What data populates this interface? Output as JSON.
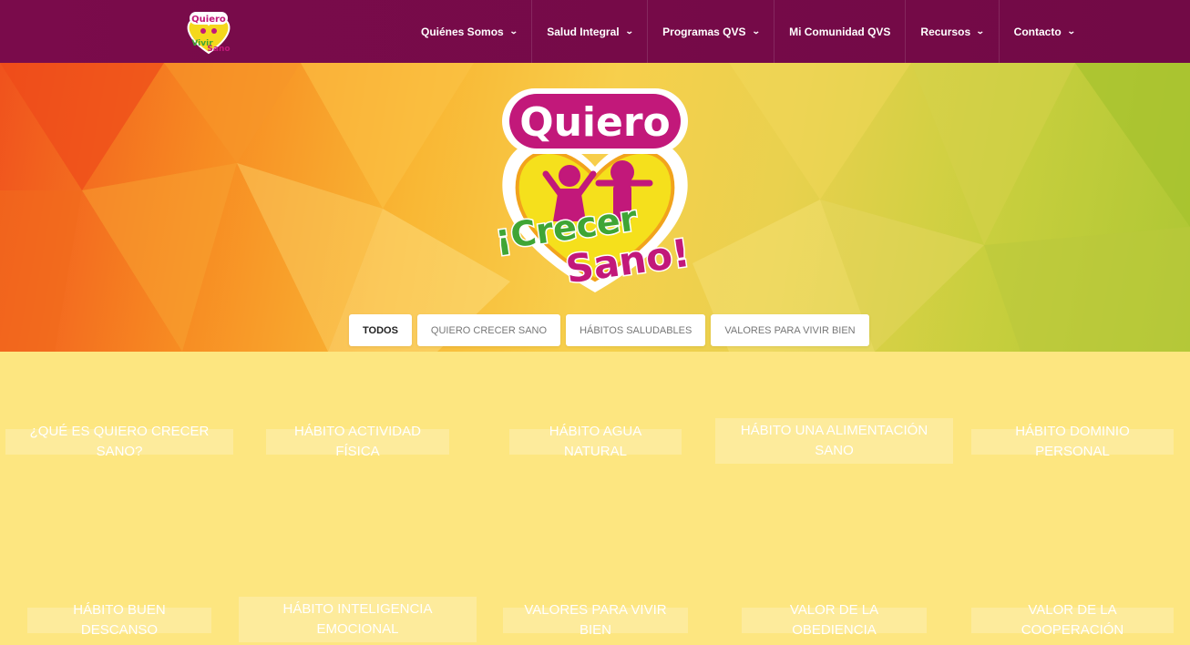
{
  "nav": {
    "logo_top": "Quiero",
    "logo_bottom": "Vivir Sano",
    "items": [
      {
        "label": "Quiénes Somos",
        "has_dropdown": true
      },
      {
        "label": "Salud Integral",
        "has_dropdown": true
      },
      {
        "label": "Programas QVS",
        "has_dropdown": true
      },
      {
        "label": "Mi Comunidad QVS",
        "has_dropdown": false
      },
      {
        "label": "Recursos",
        "has_dropdown": true
      },
      {
        "label": "Contacto",
        "has_dropdown": true
      }
    ]
  },
  "hero": {
    "logo_top": "Quiero",
    "logo_line1": "¡Crecer",
    "logo_line2": "Sano!",
    "filters": [
      {
        "label": "TODOS",
        "active": true
      },
      {
        "label": "QUIERO CRECER SANO",
        "active": false
      },
      {
        "label": "HÁBITOS SALUDABLES",
        "active": false
      },
      {
        "label": "VALORES PARA VIVIR BIEN",
        "active": false
      }
    ]
  },
  "grid": {
    "items": [
      "¿QUÉ ES QUIERO CRECER SANO?",
      "HÁBITO ACTIVIDAD FÍSICA",
      "HÁBITO AGUA NATURAL",
      "HÁBITO UNA ALIMENTACIÓN SANO",
      "HÁBITO DOMINIO PERSONAL",
      "HÁBITO BUEN DESCANSO",
      "HÁBITO INTELIGENCIA EMOCIONAL",
      "VALORES PARA VIVIR BIEN",
      "VALOR DE LA OBEDIENCIA",
      "VALOR DE LA COOPERACIÓN"
    ]
  },
  "colors": {
    "nav_bg": "#7a0b4b",
    "grid_bg": "#fde680",
    "logo_magenta": "#c2187a",
    "logo_yellow": "#f5e01c",
    "logo_green": "#3fa535"
  }
}
